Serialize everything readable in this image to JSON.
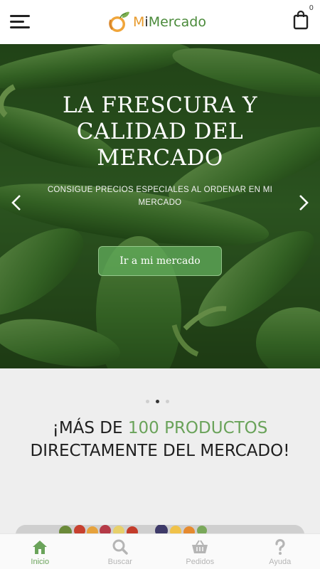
{
  "header": {
    "logo_text_m": "M",
    "logo_text_i": "i",
    "logo_text_rest": "Mercado",
    "cart_count": "0",
    "icons": {
      "menu": "hamburger-menu-icon",
      "cart": "shopping-bag-icon",
      "logo": "orange-leaf-logo-icon"
    }
  },
  "hero": {
    "title": "LA FRESCURA Y CALIDAD DEL MERCADO",
    "subtitle": "CONSIGUE PRECIOS ESPECIALES AL ORDENAR EN MI MERCADO",
    "button_label": "Ir a mi mercado",
    "icons": {
      "prev": "chevron-left-icon",
      "next": "chevron-right-icon"
    }
  },
  "carousel": {
    "slides": 3,
    "active_index": 1
  },
  "headline": {
    "part1": "¡MÁS DE ",
    "accent": "100 PRODUCTOS",
    "part2": " DIRECTAMENTE DEL MERCADO!"
  },
  "bottom_nav": {
    "items": [
      {
        "label": "Inicio",
        "icon": "home-icon",
        "active": true
      },
      {
        "label": "Buscar",
        "icon": "search-icon",
        "active": false
      },
      {
        "label": "Pedidos",
        "icon": "basket-icon",
        "active": false
      },
      {
        "label": "Ayuda",
        "icon": "question-icon",
        "active": false
      }
    ]
  },
  "colors": {
    "accent_green": "#6aa35a",
    "logo_orange": "#e79a2c",
    "nav_inactive": "#b5b5b5",
    "content_bg": "#eeeeee"
  }
}
